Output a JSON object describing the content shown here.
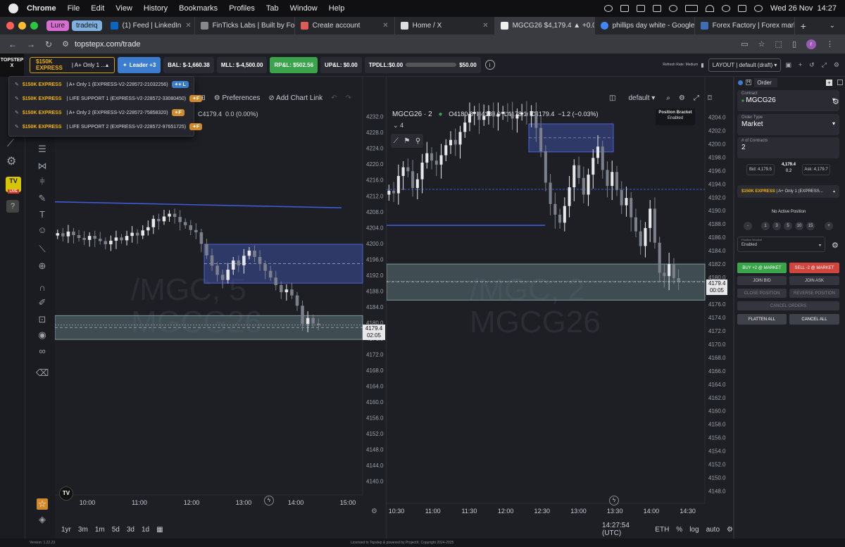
{
  "menubar": {
    "app": "Chrome",
    "items": [
      "File",
      "Edit",
      "View",
      "History",
      "Bookmarks",
      "Profiles",
      "Tab",
      "Window",
      "Help"
    ],
    "clock": "Wed 26 Nov  14:27"
  },
  "tabs": {
    "pills": [
      {
        "label": "Lure",
        "color": "#d66dd0"
      },
      {
        "label": "tradeiq",
        "color": "#7fb0e0"
      }
    ],
    "items": [
      {
        "label": "(1) Feed | LinkedIn",
        "color": "#0a66c2",
        "active": false
      },
      {
        "label": "FinTicks Labs | Built by Four",
        "color": "#888888",
        "active": false
      },
      {
        "label": "Create account",
        "color": "#e05a5a",
        "active": false
      },
      {
        "label": "Home / X",
        "color": "#dddddd",
        "active": false
      },
      {
        "label": "MGCG26 $4,179.4 ▲ +0.05",
        "color": "#eeeeee",
        "active": true
      },
      {
        "label": "phillips day white - Google",
        "color": "#4285f4",
        "active": false
      },
      {
        "label": "Forex Factory | Forex marke",
        "color": "#3e6fb5",
        "active": false
      }
    ],
    "new_tab": "+"
  },
  "address": {
    "url": "topstepx.com/trade"
  },
  "apptop": {
    "logo": "TOPSTEP X",
    "account_gold": "$150K EXPRESS",
    "account_rest": " | A+ Only 1 ...",
    "leader": "Leader +3",
    "bal": "BAL: $-1,660.38",
    "mll": "MLL: $-4,500.00",
    "rpl": "RP&L: $502.56",
    "upl": "UP&L: $0.00",
    "tpdll": "TPDLL:$0.00",
    "tpdll_right": "$50.00",
    "refresh": "Refresh Rate: Medium",
    "layout": "LAYOUT | default (draft)"
  },
  "dropdown": {
    "items": [
      {
        "gold": "$150K EXPRESS",
        "rest": " | A+ Only 1 (EXPRESS-V2-228572-21032256)",
        "tag": "+ L",
        "tag_color": "#3c7dd0"
      },
      {
        "gold": "$150K EXPRESS",
        "rest": " | LIFE SUPPORT 1 (EXPRESS-V2-228572-33080450)",
        "tag": "F",
        "tag_color": "#d08a2c"
      },
      {
        "gold": "$150K EXPRESS",
        "rest": " | A+ Only 2 (EXPRESS-V2-228572-75858320)",
        "tag": "F",
        "tag_color": "#d08a2c"
      },
      {
        "gold": "$150K EXPRESS",
        "rest": " | LIFE SUPPORT 2 (EXPRESS-V2-228572-97651725)",
        "tag": "F",
        "tag_color": "#d08a2c"
      }
    ]
  },
  "chart_left": {
    "toolbar_partial": "rs",
    "preferences": "Preferences",
    "add_chart_link": "Add Chart Link",
    "ohlc": "C4179.4  0.0 (0.00%)",
    "watermark_1": "/MGC, 5",
    "watermark_2": "MGCG26",
    "price_tag": "4179.4",
    "countdown": "02:05",
    "bottom": [
      "1yr",
      "3m",
      "1m",
      "5d",
      "3d",
      "1d"
    ]
  },
  "chart_right": {
    "symbol": "MGCG26 · 2",
    "ohlc": "O4180.8  H4180.0  L4178.1  C4179.4  −1.2 (−0.03%)",
    "layout_name": "default",
    "indicator_count": "4",
    "bracket_title": "Position Bracket",
    "bracket_state": "Enabled",
    "watermark_1": "/MGC, 2",
    "watermark_2": "MGCG26",
    "price_tag": "4179.4",
    "countdown": "00:05",
    "time": "14:27:54 (UTC)",
    "session": "ETH",
    "pct": "%",
    "log": "log",
    "auto": "auto"
  },
  "chart_data": [
    {
      "type": "candlestick",
      "title": "/MGC, 5 — MGCG26",
      "xlabel": "",
      "ylabel": "",
      "x_ticks": [
        "10:00",
        "11:00",
        "12:00",
        "13:00",
        "14:00",
        "15:00"
      ],
      "y_ticks": [
        4140.0,
        4144.0,
        4148.0,
        4152.0,
        4156.0,
        4160.0,
        4164.0,
        4168.0,
        4172.0,
        4176.0,
        4180.0,
        4184.0,
        4188.0,
        4192.0,
        4196.0,
        4200.0,
        4204.0,
        4208.0,
        4212.0,
        4216.0,
        4220.0,
        4224.0,
        4228.0,
        4232.0
      ],
      "ylim": [
        4138.0,
        4233.0
      ],
      "last_price": 4179.4,
      "series": [
        {
          "name": "MGCG26 5m",
          "values": [
            4202.6,
            4201.8,
            4203.0,
            4202.1,
            4201.4,
            4200.9,
            4201.9,
            4201.2,
            4200.6,
            4199.8,
            4200.7,
            4201.5,
            4200.8,
            4201.9,
            4202.7,
            4202.0,
            4203.3,
            4204.1,
            4206.2,
            4205.6,
            4206.8,
            4207.5,
            4206.7,
            4205.4,
            4204.6,
            4203.4,
            4202.8,
            4199.9,
            4197.0,
            4194.4,
            4192.1,
            4190.8,
            4193.4,
            4195.7,
            4194.5,
            4196.9,
            4198.2,
            4196.6,
            4194.8,
            4193.1,
            4191.4,
            4189.5,
            4187.7,
            4188.4,
            4186.9,
            4184.3,
            4179.7,
            4181.2,
            4179.8,
            4179.4
          ]
        }
      ],
      "levels": [
        {
          "type": "trendline",
          "from": 4210.5,
          "to": 4209.0,
          "color": "#3d5bd6"
        },
        {
          "type": "zone",
          "from": 4190.0,
          "to": 4199.8,
          "color": "#3d4f9e"
        },
        {
          "type": "zone",
          "from": 4175.8,
          "to": 4181.8,
          "color": "#5b7378"
        }
      ]
    },
    {
      "type": "candlestick",
      "title": "/MGC, 2 — MGCG26",
      "xlabel": "",
      "ylabel": "",
      "x_ticks": [
        "10:30",
        "11:00",
        "11:30",
        "12:00",
        "12:30",
        "13:00",
        "13:30",
        "14:00",
        "14:30"
      ],
      "y_ticks": [
        4148.0,
        4150.0,
        4152.0,
        4154.0,
        4156.0,
        4158.0,
        4160.0,
        4162.0,
        4164.0,
        4166.0,
        4168.0,
        4170.0,
        4172.0,
        4174.0,
        4176.0,
        4178.0,
        4180.0,
        4182.0,
        4184.0,
        4186.0,
        4188.0,
        4190.0,
        4192.0,
        4194.0,
        4196.0,
        4198.0,
        4200.0,
        4202.0,
        4204.0
      ],
      "ylim": [
        4147.0,
        4205.0
      ],
      "last_price": 4179.4,
      "series": [
        {
          "name": "MGCG26 2m",
          "values": [
            4193.0,
            4192.6,
            4195.2,
            4196.5,
            4195.9,
            4193.4,
            4194.7,
            4197.2,
            4198.6,
            4197.5,
            4196.9,
            4198.3,
            4199.8,
            4200.6,
            4199.9,
            4201.8,
            4203.2,
            4204.5,
            4204.8,
            4203.6,
            4204.2,
            4204.9,
            4204.1,
            4204.5,
            4204.8,
            4204.6,
            4203.8,
            4204.4,
            4204.7,
            4204.2,
            4204.9,
            4202.4,
            4198.9,
            4194.2,
            4191.0,
            4189.4,
            4188.2,
            4190.7,
            4193.5,
            4196.8,
            4194.9,
            4192.4,
            4195.4,
            4197.9,
            4199.6,
            4196.1,
            4193.7,
            4195.8,
            4193.1,
            4190.8,
            4191.9,
            4189.0,
            4186.9,
            4184.7,
            4187.4,
            4190.3,
            4185.2,
            4180.7,
            4180.2,
            4182.0,
            4179.9,
            4179.4
          ]
        }
      ],
      "levels": [
        {
          "type": "zone",
          "from": 4198.8,
          "to": 4203.0,
          "color": "#3d4f9e"
        },
        {
          "type": "hline",
          "value": 4187.8,
          "color": "#3d5bd6"
        },
        {
          "type": "hline",
          "value": 4193.2,
          "color": "#3d5bd6"
        },
        {
          "type": "zone",
          "from": 4176.6,
          "to": 4182.0,
          "color": "#5b7378"
        }
      ]
    }
  ],
  "order": {
    "tab": "Order",
    "contract_label": "Contract",
    "contract": "MGCG26",
    "order_type_label": "Order Type",
    "order_type": "Market",
    "contracts_label": "# of Contracts",
    "contracts": "2",
    "bid": "Bid: 4,179.5",
    "last": "4,179.4",
    "spread": "0.2",
    "ask": "Ask: 4,179.7",
    "account_gold": "$150K EXPRESS",
    "account_rest": " | A+ Only 1 (EXPRESS...",
    "no_position": "No Active Position",
    "qty_buttons": [
      "-",
      "1",
      "3",
      "5",
      "10",
      "15",
      "+"
    ],
    "bracket_label": "Position Bracket",
    "bracket_value": "Enabled",
    "buy": "BUY +2 @ MARKET",
    "sell": "SELL -2 @ MARKET",
    "join_bid": "JOIN BID",
    "join_ask": "JOIN ASK",
    "close_position": "CLOSE POSITION",
    "reverse_position": "REVERSE POSITION",
    "cancel_orders": "CANCEL ORDERS",
    "flatten_all": "FLATTEN ALL",
    "cancel_all": "CANCEL ALL"
  },
  "footer": {
    "version": "Version: 1.22.23",
    "license": "Licensed to Topstep & powered by ProjectX. Copyright 2024-2025"
  },
  "colors": {
    "up_candle": "#e8e8ea",
    "down_candle": "#7c808a",
    "buy": "#3aa44a",
    "sell": "#d0453d",
    "accent": "#3c7dd0"
  }
}
